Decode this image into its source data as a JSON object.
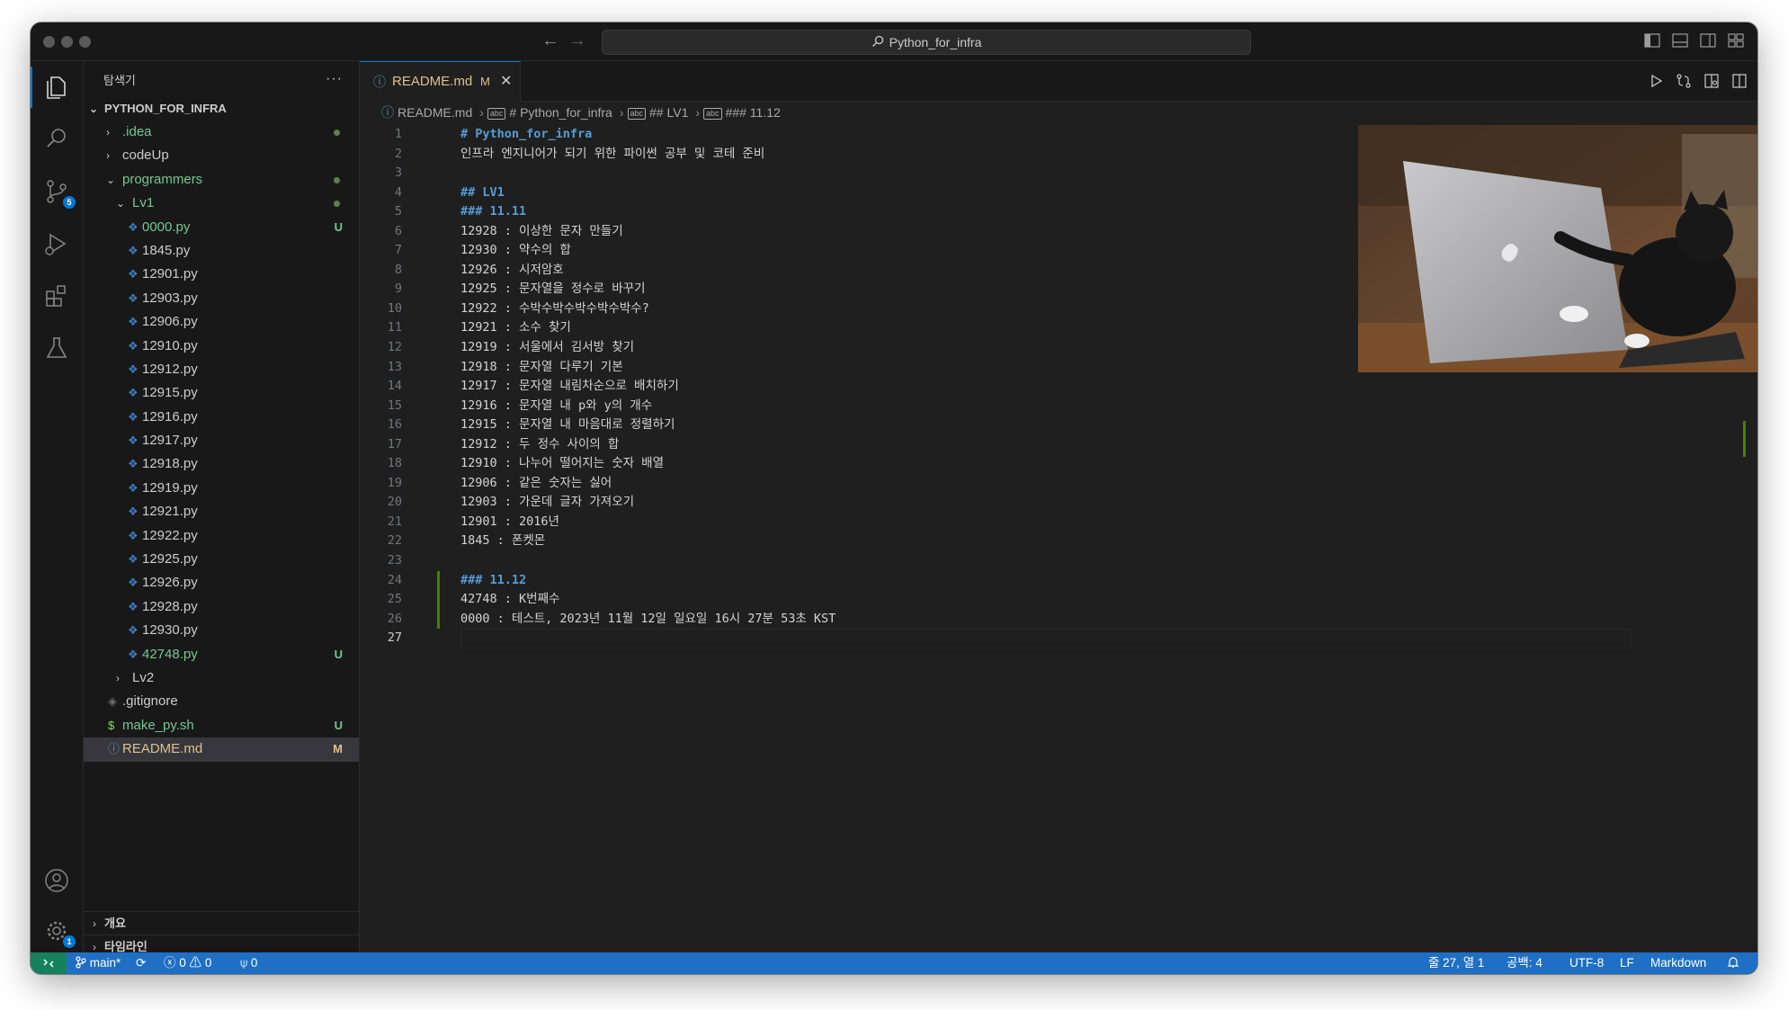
{
  "window": {
    "title": "Python_for_infra"
  },
  "activity_bar": {
    "scm_badge": "5",
    "settings_badge": "1"
  },
  "sidebar": {
    "title": "탐색기",
    "more": "···",
    "root": "PYTHON_FOR_INFRA",
    "items": [
      {
        "label": ".idea",
        "depth": 1,
        "kind": "folder",
        "open": false,
        "color": "#73c991",
        "dot": true
      },
      {
        "label": "codeUp",
        "depth": 1,
        "kind": "folder",
        "open": false,
        "color": "#cccccc"
      },
      {
        "label": "programmers",
        "depth": 1,
        "kind": "folder",
        "open": true,
        "color": "#73c991",
        "dot": true
      },
      {
        "label": "Lv1",
        "depth": 2,
        "kind": "folder",
        "open": true,
        "color": "#73c991",
        "dot": true
      },
      {
        "label": "0000.py",
        "depth": 3,
        "kind": "py",
        "color": "#73c991",
        "status": "U"
      },
      {
        "label": "1845.py",
        "depth": 3,
        "kind": "py",
        "color": "#cccccc"
      },
      {
        "label": "12901.py",
        "depth": 3,
        "kind": "py",
        "color": "#cccccc"
      },
      {
        "label": "12903.py",
        "depth": 3,
        "kind": "py",
        "color": "#cccccc"
      },
      {
        "label": "12906.py",
        "depth": 3,
        "kind": "py",
        "color": "#cccccc"
      },
      {
        "label": "12910.py",
        "depth": 3,
        "kind": "py",
        "color": "#cccccc"
      },
      {
        "label": "12912.py",
        "depth": 3,
        "kind": "py",
        "color": "#cccccc"
      },
      {
        "label": "12915.py",
        "depth": 3,
        "kind": "py",
        "color": "#cccccc"
      },
      {
        "label": "12916.py",
        "depth": 3,
        "kind": "py",
        "color": "#cccccc"
      },
      {
        "label": "12917.py",
        "depth": 3,
        "kind": "py",
        "color": "#cccccc"
      },
      {
        "label": "12918.py",
        "depth": 3,
        "kind": "py",
        "color": "#cccccc"
      },
      {
        "label": "12919.py",
        "depth": 3,
        "kind": "py",
        "color": "#cccccc"
      },
      {
        "label": "12921.py",
        "depth": 3,
        "kind": "py",
        "color": "#cccccc"
      },
      {
        "label": "12922.py",
        "depth": 3,
        "kind": "py",
        "color": "#cccccc"
      },
      {
        "label": "12925.py",
        "depth": 3,
        "kind": "py",
        "color": "#cccccc"
      },
      {
        "label": "12926.py",
        "depth": 3,
        "kind": "py",
        "color": "#cccccc"
      },
      {
        "label": "12928.py",
        "depth": 3,
        "kind": "py",
        "color": "#cccccc"
      },
      {
        "label": "12930.py",
        "depth": 3,
        "kind": "py",
        "color": "#cccccc"
      },
      {
        "label": "42748.py",
        "depth": 3,
        "kind": "py",
        "color": "#73c991",
        "status": "U"
      },
      {
        "label": "Lv2",
        "depth": 2,
        "kind": "folder",
        "open": false,
        "color": "#cccccc"
      },
      {
        "label": ".gitignore",
        "depth": 1,
        "kind": "gitignore",
        "color": "#cccccc"
      },
      {
        "label": "make_py.sh",
        "depth": 1,
        "kind": "sh",
        "color": "#73c991",
        "status": "U"
      },
      {
        "label": "README.md",
        "depth": 1,
        "kind": "md",
        "color": "#e2c08d",
        "status": "M",
        "selected": true
      }
    ],
    "sections": [
      "개요",
      "타임라인"
    ]
  },
  "editor": {
    "tab": {
      "label": "README.md",
      "modified": "M",
      "close": "✕"
    },
    "breadcrumb": [
      "README.md",
      "# Python_for_infra",
      "## LV1",
      "### 11.12"
    ],
    "lines": [
      {
        "n": "1",
        "text": "# Python_for_infra",
        "heading": true
      },
      {
        "n": "2",
        "text": "인프라 엔지니어가 되기 위한 파이썬 공부 및 코테 준비"
      },
      {
        "n": "3",
        "text": ""
      },
      {
        "n": "4",
        "text": "## LV1",
        "heading": true
      },
      {
        "n": "5",
        "text": "### 11.11",
        "heading": true
      },
      {
        "n": "6",
        "text": "12928 : 이상한 문자 만들기"
      },
      {
        "n": "7",
        "text": "12930 : 약수의 합"
      },
      {
        "n": "8",
        "text": "12926 : 시저암호"
      },
      {
        "n": "9",
        "text": "12925 : 문자열을 정수로 바꾸기"
      },
      {
        "n": "10",
        "text": "12922 : 수박수박수박수박수박수?"
      },
      {
        "n": "11",
        "text": "12921 : 소수 찾기"
      },
      {
        "n": "12",
        "text": "12919 : 서울에서 김서방 찾기"
      },
      {
        "n": "13",
        "text": "12918 : 문자열 다루기 기본"
      },
      {
        "n": "14",
        "text": "12917 : 문자열 내림차순으로 배치하기"
      },
      {
        "n": "15",
        "text": "12916 : 문자열 내 p와 y의 개수"
      },
      {
        "n": "16",
        "text": "12915 : 문자열 내 마음대로 정렬하기"
      },
      {
        "n": "17",
        "text": "12912 : 두 정수 사이의 합"
      },
      {
        "n": "18",
        "text": "12910 : 나누어 떨어지는 숫자 배열"
      },
      {
        "n": "19",
        "text": "12906 : 같은 숫자는 싫어"
      },
      {
        "n": "20",
        "text": "12903 : 가운데 글자 가져오기"
      },
      {
        "n": "21",
        "text": "12901 : 2016년"
      },
      {
        "n": "22",
        "text": "1845 : 폰켓몬"
      },
      {
        "n": "23",
        "text": ""
      },
      {
        "n": "24",
        "text": "### 11.12",
        "heading": true
      },
      {
        "n": "25",
        "text": "42748 : K번째수"
      },
      {
        "n": "26",
        "text": "0000 : 테스트, 2023년 11월 12일 일요일 16시 27분 53초 KST"
      },
      {
        "n": "27",
        "text": ""
      }
    ]
  },
  "statusbar": {
    "branch": "main*",
    "errors": "0",
    "warnings": "0",
    "ports": "0",
    "position": "줄 27, 열 1",
    "indent": "공백: 4",
    "encoding": "UTF-8",
    "eol": "LF",
    "language": "Markdown"
  },
  "colors": {
    "accent": "#0078d4",
    "statusbar": "#1f6fc5",
    "git_added": "#73c991",
    "git_modified": "#e2c08d",
    "heading": "#569cd6"
  }
}
